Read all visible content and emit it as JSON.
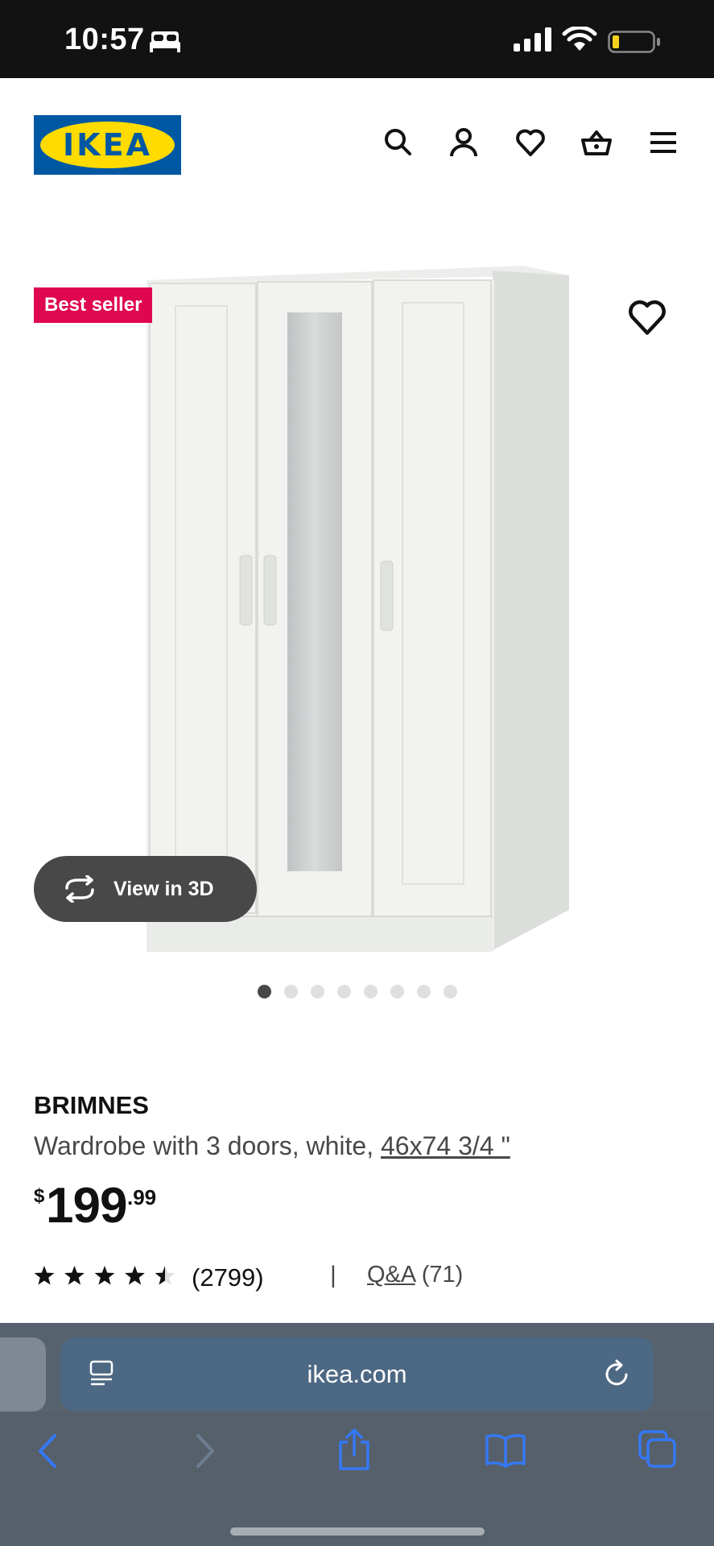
{
  "status_bar": {
    "time": "10:57"
  },
  "header": {
    "logo_text": "IKEA",
    "logo_registered": "®"
  },
  "product": {
    "badge": "Best seller",
    "view_3d_label": "View in 3D",
    "image_count": 8,
    "active_image_index": 0,
    "name": "BRIMNES",
    "description": "Wardrobe with 3 doors, white, ",
    "size_link": "46x74 3/4 \"",
    "price_currency": "$",
    "price_integer": "199",
    "price_decimal": ".99",
    "rating": 4.5,
    "review_count": "(2799)",
    "separator": "|",
    "qa_label": "Q&A",
    "qa_count": "(71)"
  },
  "browser": {
    "url": "ikea.com"
  },
  "colors": {
    "ikea_blue": "#0058a3",
    "ikea_yellow": "#ffdb00",
    "badge_red": "#e00751",
    "safari_blue": "#3478f6"
  }
}
